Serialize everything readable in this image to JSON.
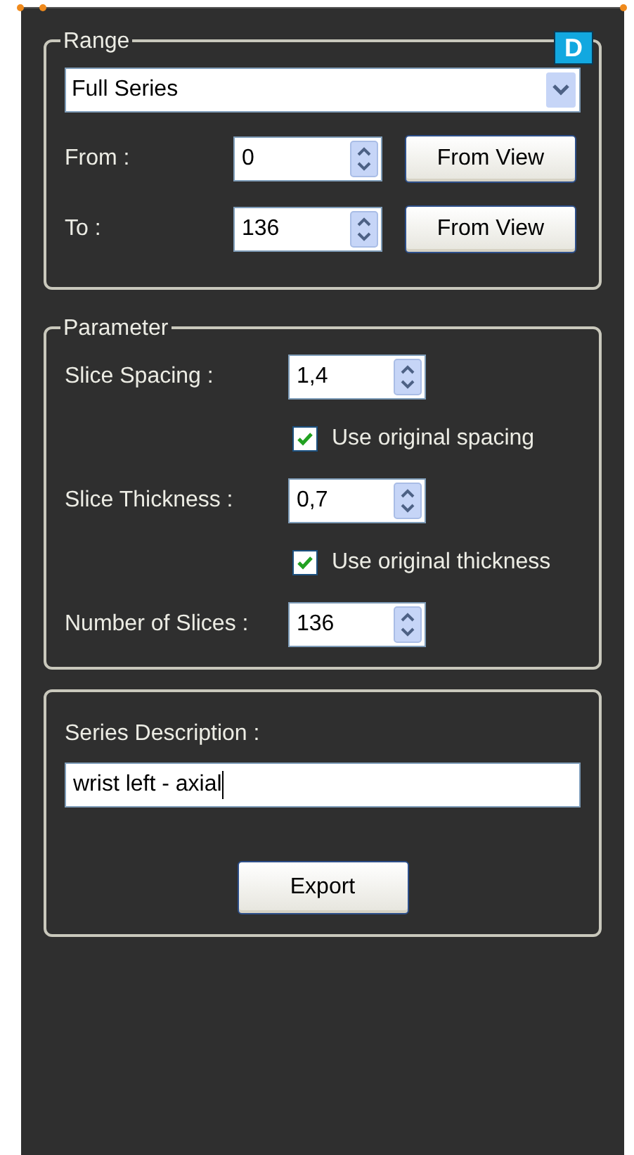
{
  "badge": "D",
  "range": {
    "title": "Range",
    "dropdown": {
      "value": "Full Series"
    },
    "rows": [
      {
        "label": "From :",
        "value": "0",
        "button": "From View"
      },
      {
        "label": "To :",
        "value": "136",
        "button": "From View"
      }
    ]
  },
  "parameter": {
    "title": "Parameter",
    "rows": [
      {
        "kind": "spin",
        "label": "Slice Spacing :",
        "value": "1,4"
      },
      {
        "kind": "checkbox",
        "label": "Use original spacing",
        "checked": true
      },
      {
        "kind": "spin",
        "label": "Slice Thickness :",
        "value": "0,7"
      },
      {
        "kind": "checkbox",
        "label": "Use original thickness",
        "checked": true
      },
      {
        "kind": "spin",
        "label": "Number of Slices :",
        "value": "136"
      }
    ]
  },
  "series": {
    "label": "Series Description :",
    "value": "wrist left - axial",
    "button": "Export"
  }
}
